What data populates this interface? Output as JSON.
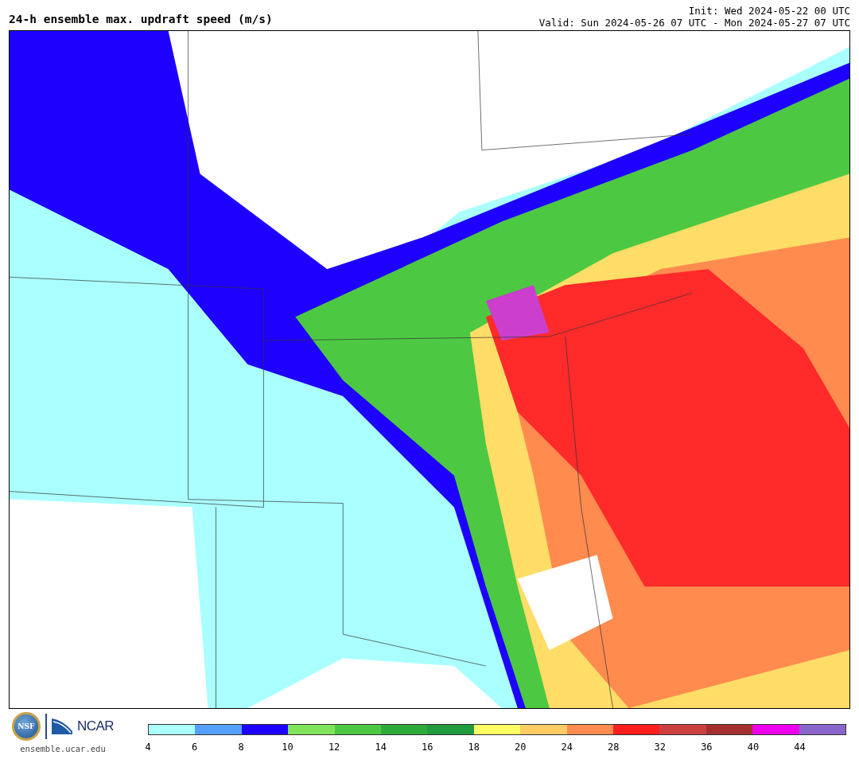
{
  "header": {
    "title": "24-h ensemble max. updraft speed (m/s)",
    "init": "Init: Wed 2024-05-22 00 UTC",
    "valid": "Valid: Sun 2024-05-26 07 UTC - Mon 2024-05-27 07 UTC"
  },
  "logos": {
    "nsf": "NSF",
    "ncar": "NCAR",
    "site": "ensemble.ucar.edu"
  },
  "colorbar": {
    "bins": [
      {
        "color": "#aaffff"
      },
      {
        "color": "#55a0ff"
      },
      {
        "color": "#1e00ff"
      },
      {
        "color": "#80e45a"
      },
      {
        "color": "#4dc842"
      },
      {
        "color": "#2eaa3a"
      },
      {
        "color": "#229a3e"
      },
      {
        "color": "#ffff66"
      },
      {
        "color": "#ffcc66"
      },
      {
        "color": "#ff8b4f"
      },
      {
        "color": "#ff1e1e"
      },
      {
        "color": "#cc4040"
      },
      {
        "color": "#a52f2f"
      },
      {
        "color": "#ee00ee"
      },
      {
        "color": "#8a66cc"
      }
    ],
    "ticks": [
      "4",
      "6",
      "8",
      "10",
      "12",
      "14",
      "16",
      "18",
      "20",
      "24",
      "28",
      "32",
      "36",
      "40",
      "44"
    ]
  }
}
